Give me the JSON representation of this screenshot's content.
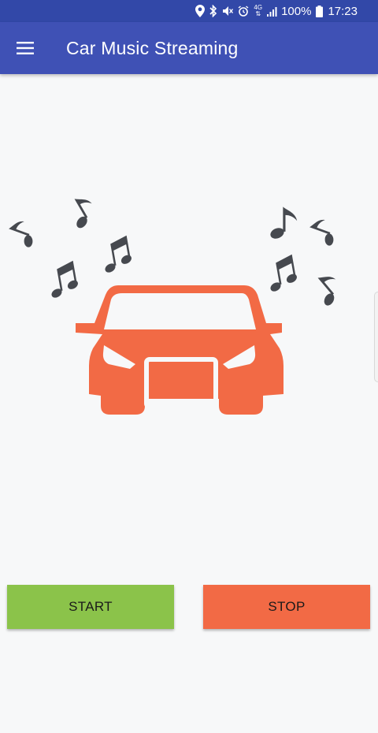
{
  "status_bar": {
    "icons": [
      "location-icon",
      "bluetooth-icon",
      "mute-icon",
      "alarm-icon",
      "network-4g-icon",
      "signal-icon",
      "battery-icon"
    ],
    "network_label": "4G",
    "battery": "100%",
    "time": "17:23"
  },
  "app_bar": {
    "title": "Car Music Streaming",
    "menu_icon": "hamburger-menu-icon"
  },
  "illustration": {
    "car_color": "#f26a45",
    "note_color": "#46494f",
    "icons": [
      "car-icon",
      "music-note-icon"
    ]
  },
  "buttons": {
    "start_label": "START",
    "stop_label": "STOP",
    "start_color": "#8bc34a",
    "stop_color": "#f26a45"
  },
  "colors": {
    "status_bar": "#3248a8",
    "app_bar": "#3f51b5",
    "background": "#f7f8f9"
  }
}
